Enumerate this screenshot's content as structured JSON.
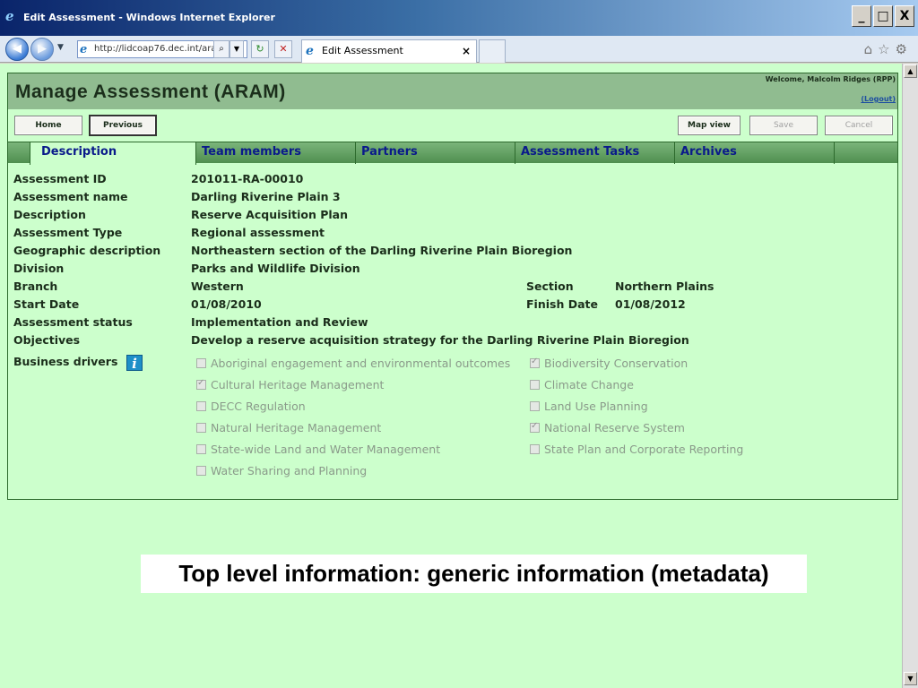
{
  "window": {
    "title": "Edit Assessment - Windows Internet Explorer",
    "minimize": "_",
    "maximize": "□",
    "close": "X"
  },
  "browser": {
    "address": "http://lidcoap76.dec.int/ara",
    "tab_title": "Edit Assessment",
    "tab_close": "×"
  },
  "header": {
    "title": "Manage Assessment (ARAM)",
    "welcome": "Welcome, Malcolm Ridges (RPP)",
    "logout": "(Logout)"
  },
  "toolbar": {
    "home": "Home",
    "previous": "Previous",
    "map_view": "Map view",
    "save": "Save",
    "cancel": "Cancel"
  },
  "tabs": [
    {
      "label": "Description"
    },
    {
      "label": "Team members"
    },
    {
      "label": "Partners"
    },
    {
      "label": "Assessment Tasks"
    },
    {
      "label": "Archives"
    }
  ],
  "fields": [
    {
      "label": "Assessment ID",
      "value": "201011-RA-00010"
    },
    {
      "label": "Assessment name",
      "value": "Darling Riverine Plain 3"
    },
    {
      "label": "Description",
      "value": "Reserve Acquisition Plan"
    },
    {
      "label": "Assessment Type",
      "value": "Regional assessment"
    },
    {
      "label": "Geographic description",
      "value": "Northeastern section of the Darling Riverine Plain Bioregion"
    },
    {
      "label": "Division",
      "value": "Parks and Wildlife Division"
    },
    {
      "label": "Branch",
      "value": "Western"
    },
    {
      "label": "Start Date",
      "value": "01/08/2010"
    },
    {
      "label": "Assessment status",
      "value": "Implementation and Review"
    },
    {
      "label": "Objectives",
      "value": "Develop a reserve acquisition strategy for the Darling Riverine Plain Bioregion"
    }
  ],
  "extra_fields": {
    "section_label": "Section",
    "section_value": "Northern Plains",
    "finish_label": "Finish Date",
    "finish_value": "01/08/2012"
  },
  "business_drivers": {
    "label": "Business drivers",
    "info_icon": "i",
    "options": [
      {
        "label": "Aboriginal engagement and environmental outcomes",
        "checked": false
      },
      {
        "label": "Biodiversity Conservation",
        "checked": true
      },
      {
        "label": "Cultural Heritage Management",
        "checked": true
      },
      {
        "label": "Climate Change",
        "checked": false
      },
      {
        "label": "DECC Regulation",
        "checked": false
      },
      {
        "label": "Land Use Planning",
        "checked": false
      },
      {
        "label": "Natural Heritage Management",
        "checked": false
      },
      {
        "label": "National Reserve System",
        "checked": true
      },
      {
        "label": "State-wide Land and Water Management",
        "checked": false
      },
      {
        "label": "State Plan and Corporate Reporting",
        "checked": false
      },
      {
        "label": "Water Sharing and Planning",
        "checked": false
      }
    ]
  },
  "caption": "Top level information: generic information (metadata)"
}
